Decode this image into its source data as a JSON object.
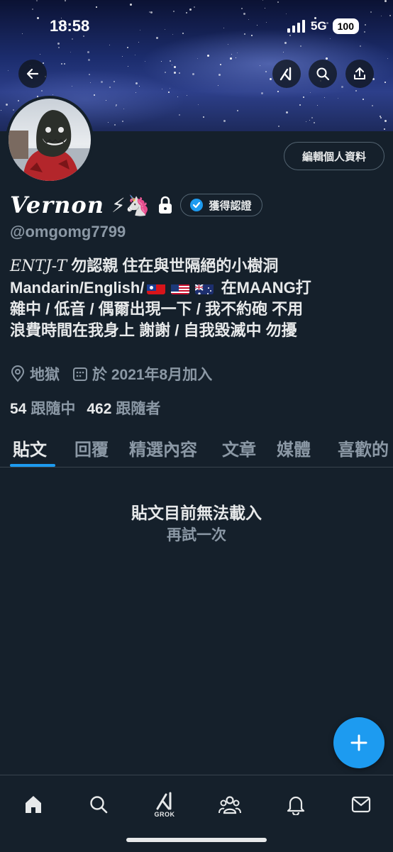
{
  "status_bar": {
    "time": "18:58",
    "network": "5G",
    "battery": "100"
  },
  "profile": {
    "name": "Vernon",
    "name_emojis": "⚡🦄",
    "handle": "@omgomg7799",
    "verified_label": "獲得認證",
    "edit_profile_label": "編輯個人資料",
    "bio": {
      "line1_prefix": "ENTJ-T",
      "line1_rest": " 勿認親 住在與世隔絕的小樹洞",
      "line2_prefix": "Mandarin/English/",
      "line2_suffix": "在MAANG打",
      "line3": "雜中 / 低音 / 偶爾出現一下 / 我不約砲 不用",
      "line4": "浪費時間在我身上 謝謝 / 自我毀滅中 勿擾"
    },
    "location": "地獄",
    "joined": "於 2021年8月加入",
    "following_count": "54",
    "following_label": "跟隨中",
    "followers_count": "462",
    "followers_label": "跟隨者"
  },
  "tabs": [
    {
      "label": "貼文",
      "active": true
    },
    {
      "label": "回覆",
      "active": false
    },
    {
      "label": "精選內容",
      "active": false
    },
    {
      "label": "文章",
      "active": false
    },
    {
      "label": "媒體",
      "active": false
    },
    {
      "label": "喜歡的",
      "active": false
    }
  ],
  "feed": {
    "error_message": "貼文目前無法載入",
    "retry_label": "再試一次"
  },
  "bottom_nav": {
    "grok_label": "GROK"
  },
  "colors": {
    "background": "#15202b",
    "accent": "#1d9bf0",
    "muted": "#8b98a5",
    "text": "#e7e9ea"
  },
  "icons": [
    "back-arrow-icon",
    "grok-icon",
    "search-icon",
    "share-icon",
    "lock-icon",
    "verified-badge-icon",
    "location-icon",
    "calendar-icon",
    "plus-icon",
    "home-icon",
    "search-nav-icon",
    "grok-nav-icon",
    "communities-icon",
    "notifications-icon",
    "messages-icon"
  ]
}
